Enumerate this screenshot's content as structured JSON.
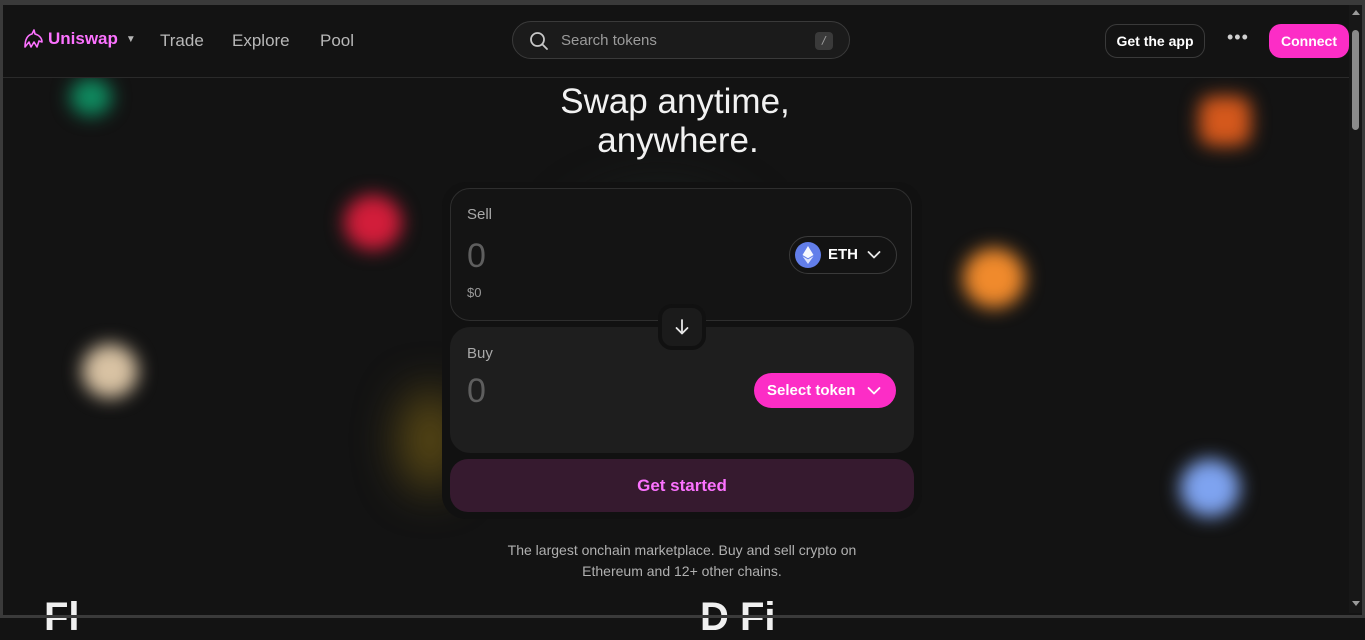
{
  "nav": {
    "brand": "Uniswap",
    "links": [
      {
        "label": "Trade"
      },
      {
        "label": "Explore"
      },
      {
        "label": "Pool"
      }
    ],
    "search_placeholder": "Search tokens",
    "search_shortcut": "/",
    "get_app_label": "Get the app",
    "more_label": "•••",
    "connect_label": "Connect"
  },
  "hero": {
    "line1": "Swap anytime,",
    "line2": "anywhere."
  },
  "swap": {
    "sell_label": "Sell",
    "sell_amount": "0",
    "sell_usd": "$0",
    "sell_token": "ETH",
    "buy_label": "Buy",
    "buy_amount": "0",
    "select_token_label": "Select token",
    "cta_label": "Get started"
  },
  "tagline": {
    "line1": "The largest onchain marketplace. Buy and sell crypto on",
    "line2": "Ethereum and 12+ other chains."
  },
  "bottom": {
    "left": "Fl   ",
    "right": "D   Fi"
  },
  "colors": {
    "accent": "#fc2dc6",
    "accent_text": "#fc72ff",
    "background": "#131313"
  }
}
